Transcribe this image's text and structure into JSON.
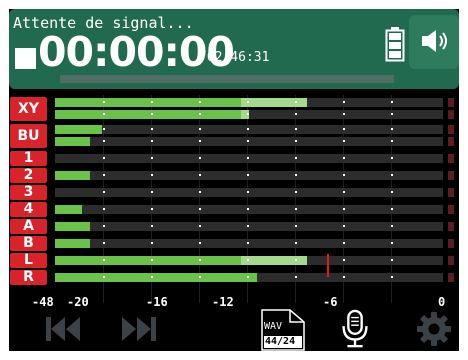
{
  "header": {
    "status": "Attente de signal...",
    "timecode": "00:00:00",
    "remaining": "/02:46:31",
    "progress": 0.0
  },
  "icons": {
    "stop": "stop-icon",
    "battery": "battery-icon",
    "speaker": "speaker-icon",
    "prev": "skip-previous-icon",
    "next": "skip-next-icon",
    "file_format": "wav-file-icon",
    "mic": "microphone-icon",
    "settings": "gear-icon"
  },
  "tracks": [
    {
      "label": "XY",
      "rows": [
        {
          "level": 0.48,
          "peak": 0.65
        },
        {
          "level": 0.48,
          "peak": 0.5
        }
      ]
    },
    {
      "label": "BU",
      "rows": [
        {
          "level": 0.12,
          "peak": 0.12
        },
        {
          "level": 0.09,
          "peak": 0.09
        }
      ]
    },
    {
      "label": "1",
      "rows": [
        {
          "level": 0.0,
          "peak": 0.0
        }
      ]
    },
    {
      "label": "2",
      "rows": [
        {
          "level": 0.09,
          "peak": 0.09
        }
      ]
    },
    {
      "label": "3",
      "rows": [
        {
          "level": 0.0,
          "peak": 0.0
        }
      ]
    },
    {
      "label": "4",
      "rows": [
        {
          "level": 0.07,
          "peak": 0.07
        }
      ]
    },
    {
      "label": "A",
      "rows": [
        {
          "level": 0.09,
          "peak": 0.09
        }
      ]
    },
    {
      "label": "B",
      "rows": [
        {
          "level": 0.09,
          "peak": 0.09
        }
      ]
    },
    {
      "label": "L",
      "rows": [
        {
          "level": 0.48,
          "peak": 0.65
        }
      ]
    },
    {
      "label": "R",
      "rows": [
        {
          "level": 0.52,
          "peak": 0.52
        }
      ]
    }
  ],
  "peak_hold": 0.7,
  "scale": {
    "labels": [
      "-48",
      "-20",
      "-16",
      "-12",
      "-6",
      "0"
    ]
  },
  "file_format": {
    "type": "WAV",
    "spec": "44/24"
  },
  "colors": {
    "header_bg": "#226a4f",
    "meter_green": "#6ac24a",
    "meter_peak": "#a7d98c",
    "track_label": "#d9232b",
    "peak_marker": "#e01b24"
  }
}
